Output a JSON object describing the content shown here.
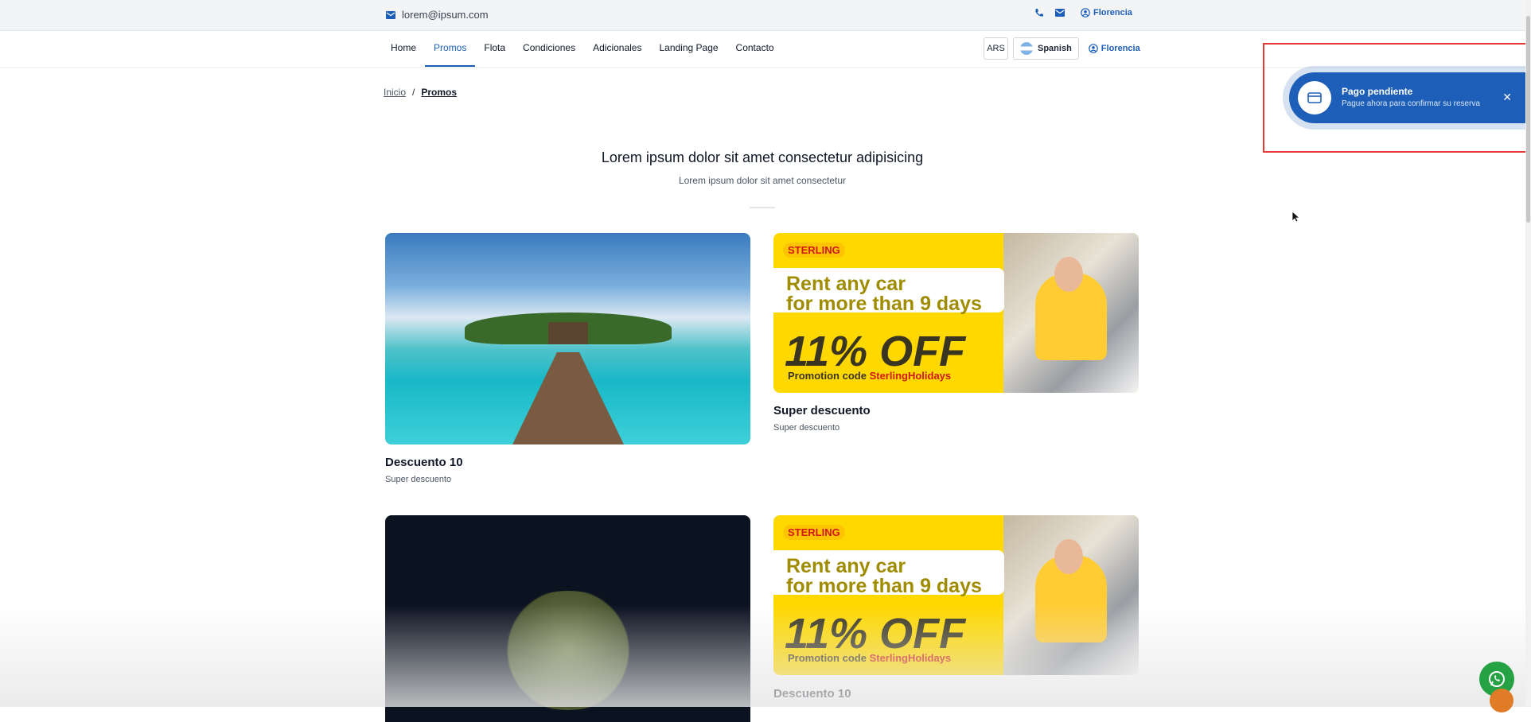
{
  "topbar": {
    "email": "lorem@ipsum.com",
    "user": "Florencia"
  },
  "nav": {
    "links": [
      "Home",
      "Promos",
      "Flota",
      "Condiciones",
      "Adicionales",
      "Landing Page",
      "Contacto"
    ],
    "active": "Promos",
    "currency": "ARS",
    "language": "Spanish",
    "user": "Florencia"
  },
  "breadcrumb": {
    "home": "Inicio",
    "separator": "/",
    "current": "Promos"
  },
  "hero": {
    "title": "Lorem ipsum dolor sit amet consectetur adipisicing",
    "subtitle": "Lorem ipsum dolor sit amet consectetur"
  },
  "cards": [
    {
      "title": "Descuento 10",
      "subtitle": "Super descuento",
      "image": "beach-island"
    },
    {
      "title": "Super descuento",
      "subtitle": "Super descuento",
      "image": "sterling-promo"
    },
    {
      "title": "",
      "subtitle": "",
      "image": "night-tree"
    },
    {
      "title": "Descuento 10",
      "subtitle": "",
      "image": "sterling-promo"
    }
  ],
  "promo_banner": {
    "brand": "STERLING",
    "line1": "Rent any car",
    "line2": "for more than 9 days",
    "discount": "11% OFF",
    "code_label": "Promotion code ",
    "code": "SterlingHolidays"
  },
  "toast": {
    "title": "Pago pendiente",
    "message": "Pague ahora para confirmar su reserva"
  },
  "colors": {
    "accent": "#1d5fb8",
    "highlight": "#e53935",
    "promo_yellow": "#ffd800",
    "whatsapp": "#25a244"
  }
}
